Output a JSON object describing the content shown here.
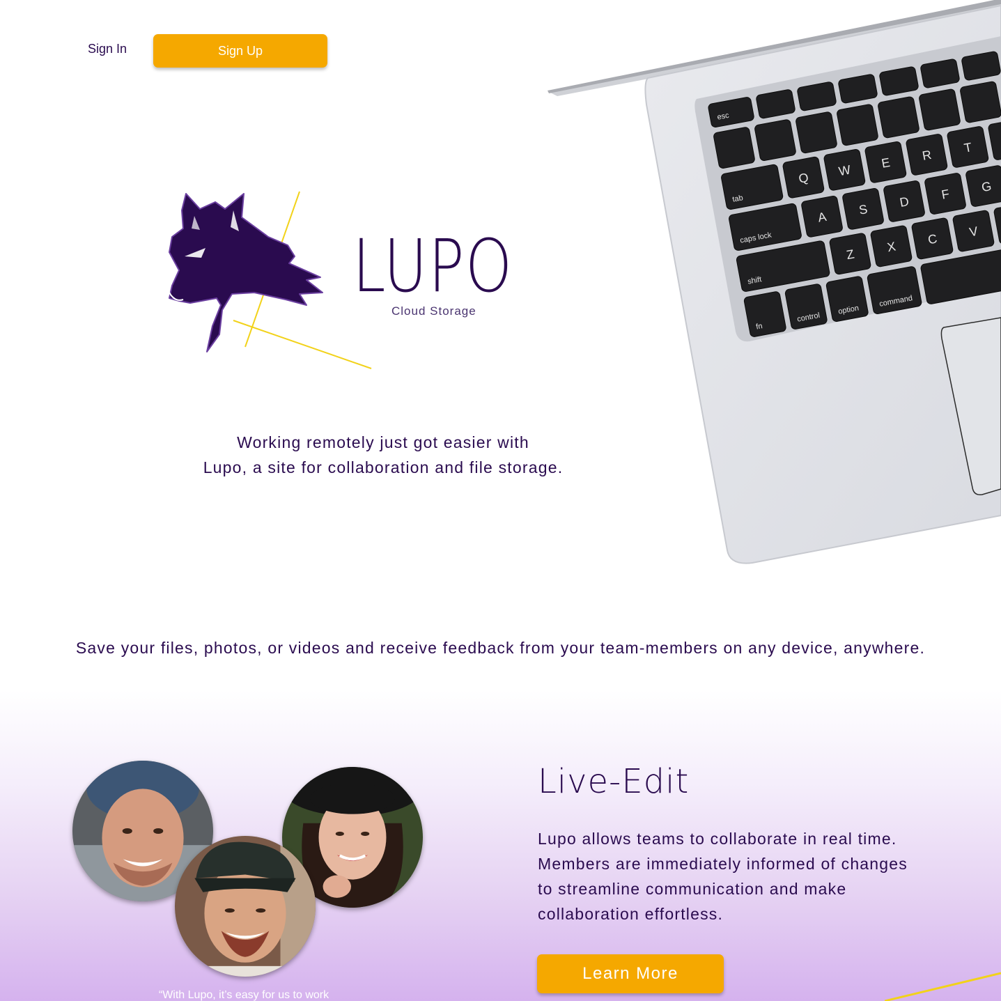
{
  "header": {
    "signin_label": "Sign In",
    "signup_label": "Sign Up"
  },
  "logo": {
    "name": "LUPO",
    "tagline": "Cloud Storage"
  },
  "intro": {
    "line1": "Working remotely just got easier with",
    "line2": "Lupo, a site for collaboration and file storage."
  },
  "save_line": "Save your files, photos, or videos and receive feedback from your team-members on any device, anywhere.",
  "feature": {
    "title": "Live-Edit",
    "lines": [
      "Lupo allows teams to collaborate in real time.",
      "Members are immediately informed of changes",
      "to streamline communication and make",
      "collaboration effortless."
    ],
    "button_label": "Learn More",
    "quote": "“With Lupo, it’s easy for us to work"
  },
  "keyboard": {
    "keys": [
      "esc",
      "tab",
      "caps lock",
      "shift",
      "fn",
      "control",
      "option",
      "command",
      "Q",
      "W",
      "E",
      "R",
      "T",
      "A",
      "S",
      "D",
      "F",
      "G",
      "Z",
      "X",
      "C",
      "V"
    ]
  },
  "colors": {
    "brand": "#2a0b4f",
    "accent": "#f5a800",
    "line": "#f2d21a",
    "gradient_end": "#d5b2ee"
  }
}
